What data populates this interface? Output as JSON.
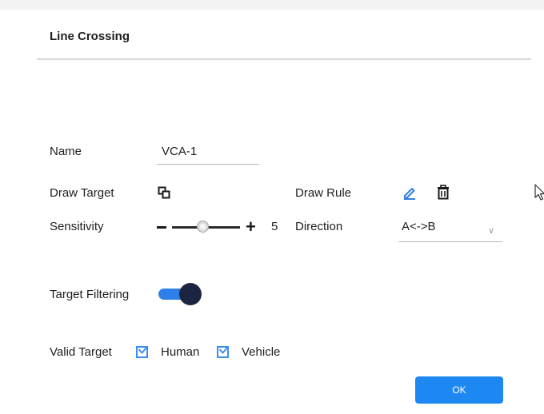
{
  "dialog": {
    "title": "Line Crossing",
    "name": {
      "label": "Name",
      "value": "VCA-1"
    },
    "draw_target": {
      "label": "Draw Target",
      "icon": "draw-rectangle-icon"
    },
    "draw_rule": {
      "label": "Draw Rule",
      "edit_icon": "pencil-icon",
      "delete_icon": "trash-icon"
    },
    "sensitivity": {
      "label": "Sensitivity",
      "minus": "–",
      "plus": "+",
      "value": "5",
      "level": 5,
      "max": 10
    },
    "direction": {
      "label": "Direction",
      "value": "A<->B"
    },
    "target_filtering": {
      "label": "Target Filtering",
      "enabled": true
    },
    "valid_target": {
      "label": "Valid Target",
      "options": [
        {
          "label": "Human",
          "checked": true
        },
        {
          "label": "Vehicle",
          "checked": true
        }
      ]
    },
    "ok_label": "OK"
  },
  "colors": {
    "accent": "#1d88f2",
    "toggle_track": "#2f7fe8",
    "toggle_knob": "#1c2540",
    "checkbox": "#3b8df0"
  }
}
